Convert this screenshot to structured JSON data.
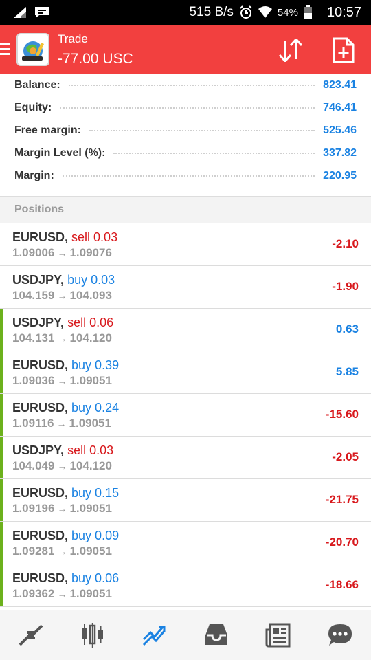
{
  "status_bar": {
    "speed": "515 B/s",
    "battery": "54%",
    "time": "10:57",
    "icons": [
      "signal-icon",
      "message-icon",
      "alarm-icon",
      "wifi-icon",
      "battery-icon"
    ]
  },
  "header": {
    "title": "Trade",
    "subtitle": "-77.00 USC",
    "accent_color": "#f2403f",
    "icons": [
      "menu-icon",
      "app-logo-icon",
      "sort-icon",
      "new-order-icon"
    ]
  },
  "account": {
    "rows": [
      {
        "label": "Balance:",
        "value": "823.41"
      },
      {
        "label": "Equity:",
        "value": "746.41"
      },
      {
        "label": "Free margin:",
        "value": "525.46"
      },
      {
        "label": "Margin Level (%):",
        "value": "337.82"
      },
      {
        "label": "Margin:",
        "value": "220.95"
      }
    ]
  },
  "positions": {
    "title": "Positions",
    "items": [
      {
        "symbol": "EURUSD,",
        "side": "sell",
        "volume": "sell 0.03",
        "open": "1.09006",
        "current": "1.09076",
        "profit": "-2.10",
        "profit_sign": "neg",
        "edge": false
      },
      {
        "symbol": "USDJPY,",
        "side": "buy",
        "volume": "buy 0.03",
        "open": "104.159",
        "current": "104.093",
        "profit": "-1.90",
        "profit_sign": "neg",
        "edge": false
      },
      {
        "symbol": "USDJPY,",
        "side": "sell",
        "volume": "sell 0.06",
        "open": "104.131",
        "current": "104.120",
        "profit": "0.63",
        "profit_sign": "pos",
        "edge": true
      },
      {
        "symbol": "EURUSD,",
        "side": "buy",
        "volume": "buy 0.39",
        "open": "1.09036",
        "current": "1.09051",
        "profit": "5.85",
        "profit_sign": "pos",
        "edge": true
      },
      {
        "symbol": "EURUSD,",
        "side": "buy",
        "volume": "buy 0.24",
        "open": "1.09116",
        "current": "1.09051",
        "profit": "-15.60",
        "profit_sign": "neg",
        "edge": true
      },
      {
        "symbol": "USDJPY,",
        "side": "sell",
        "volume": "sell 0.03",
        "open": "104.049",
        "current": "104.120",
        "profit": "-2.05",
        "profit_sign": "neg",
        "edge": true
      },
      {
        "symbol": "EURUSD,",
        "side": "buy",
        "volume": "buy 0.15",
        "open": "1.09196",
        "current": "1.09051",
        "profit": "-21.75",
        "profit_sign": "neg",
        "edge": true
      },
      {
        "symbol": "EURUSD,",
        "side": "buy",
        "volume": "buy 0.09",
        "open": "1.09281",
        "current": "1.09051",
        "profit": "-20.70",
        "profit_sign": "neg",
        "edge": true
      },
      {
        "symbol": "EURUSD,",
        "side": "buy",
        "volume": "buy 0.06",
        "open": "1.09362",
        "current": "1.09051",
        "profit": "-18.66",
        "profit_sign": "neg",
        "edge": true
      }
    ]
  },
  "bottom_nav": {
    "items": [
      {
        "icon": "quotes-icon",
        "active": false
      },
      {
        "icon": "chart-icon",
        "active": false
      },
      {
        "icon": "trade-icon",
        "active": true
      },
      {
        "icon": "history-icon",
        "active": false
      },
      {
        "icon": "news-icon",
        "active": false
      },
      {
        "icon": "chat-icon",
        "active": false
      }
    ]
  },
  "colors": {
    "sell": "#d8191d",
    "buy": "#1a82e2",
    "positive_edge": "#6cb11d",
    "nav_active": "#1a82e2",
    "nav_inactive": "#555555"
  }
}
